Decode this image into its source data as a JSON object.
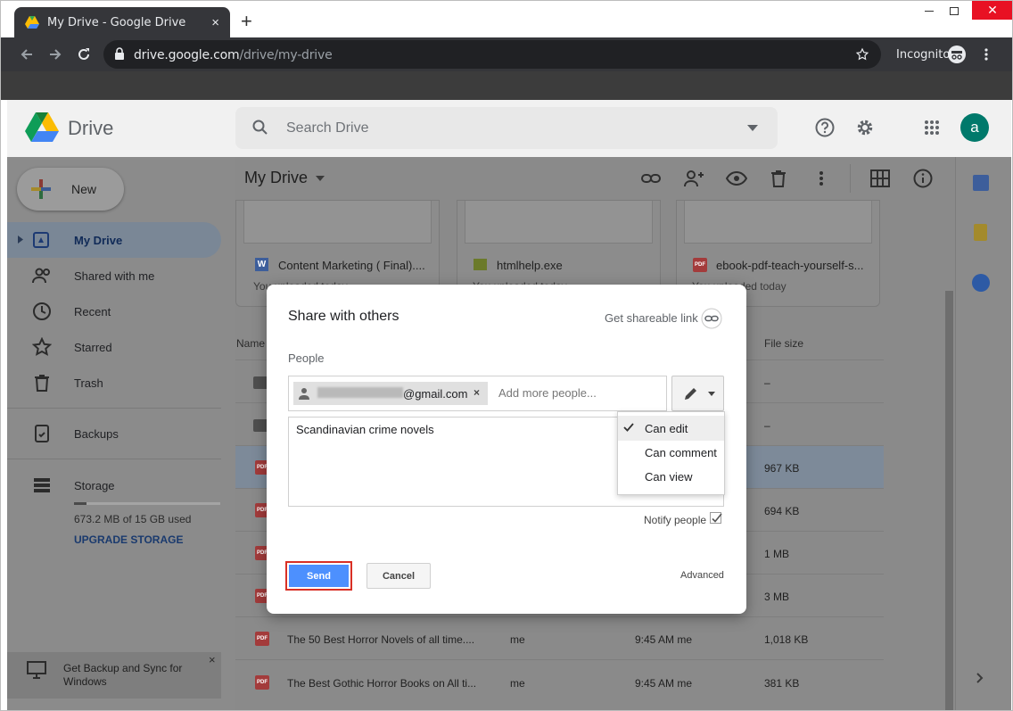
{
  "browser": {
    "tab_title": "My Drive - Google Drive",
    "tab_close": "×",
    "new_tab": "+",
    "url_host": "drive.google.com",
    "url_path": "/drive/my-drive",
    "incognito": "Incognito"
  },
  "header": {
    "app_name": "Drive",
    "search_placeholder": "Search Drive",
    "avatar_letter": "a"
  },
  "sidebar": {
    "new_label": "New",
    "items": [
      {
        "label": "My Drive"
      },
      {
        "label": "Shared with me"
      },
      {
        "label": "Recent"
      },
      {
        "label": "Starred"
      },
      {
        "label": "Trash"
      },
      {
        "label": "Backups"
      },
      {
        "label": "Storage"
      }
    ],
    "storage_used": "673.2 MB of 15 GB used",
    "upgrade": "UPGRADE STORAGE",
    "backup_promo": "Get Backup and Sync for Windows",
    "backup_close": "×"
  },
  "main": {
    "title": "My Drive",
    "cards": [
      {
        "name": "Content Marketing ( Final)....",
        "sub": "You uploaded today"
      },
      {
        "name": "htmlhelp.exe",
        "sub": "You uploaded today"
      },
      {
        "name": "ebook-pdf-teach-yourself-s...",
        "sub": "You uploaded today"
      }
    ],
    "col_name": "Name",
    "col_size": "File size",
    "rows": [
      {
        "name": "",
        "owner": "",
        "modified": "",
        "size": "–",
        "kind": "folder"
      },
      {
        "name": "",
        "owner": "",
        "modified": "",
        "size": "–",
        "kind": "folder"
      },
      {
        "name": "",
        "owner": "",
        "modified": "",
        "size": "967 KB",
        "kind": "pdf"
      },
      {
        "name": "",
        "owner": "",
        "modified": "",
        "size": "694 KB",
        "kind": "pdf"
      },
      {
        "name": "",
        "owner": "",
        "modified": "",
        "size": "1 MB",
        "kind": "pdf"
      },
      {
        "name": "",
        "owner": "",
        "modified": "",
        "size": "3 MB",
        "kind": "pdf"
      },
      {
        "name": "The 50 Best Horror Novels of all time....",
        "owner": "me",
        "modified": "9:45 AM me",
        "size": "1,018 KB",
        "kind": "pdf"
      },
      {
        "name": "The Best Gothic Horror Books on All ti...",
        "owner": "me",
        "modified": "9:45 AM me",
        "size": "381 KB",
        "kind": "pdf"
      }
    ]
  },
  "dialog": {
    "title": "Share with others",
    "shareable_link": "Get shareable link",
    "people_label": "People",
    "chip_email": "@gmail.com",
    "chip_remove": "×",
    "add_more_placeholder": "Add more people...",
    "note": "Scandinavian crime novels",
    "permission_options": [
      "Can edit",
      "Can comment",
      "Can view"
    ],
    "selected_permission": "Can edit",
    "notify_people": "Notify people",
    "send": "Send",
    "cancel": "Cancel",
    "advanced": "Advanced"
  },
  "colors": {
    "accent": "#4d90fe",
    "highlight": "#d93025",
    "avatar": "#00796b"
  },
  "icons": [
    "drive-logo-icon",
    "search-icon",
    "help-icon",
    "settings-icon",
    "apps-icon",
    "link-icon",
    "add-person-icon",
    "eye-icon",
    "trash-icon",
    "more-icon",
    "grid-icon",
    "info-icon",
    "pencil-icon",
    "check-icon"
  ]
}
